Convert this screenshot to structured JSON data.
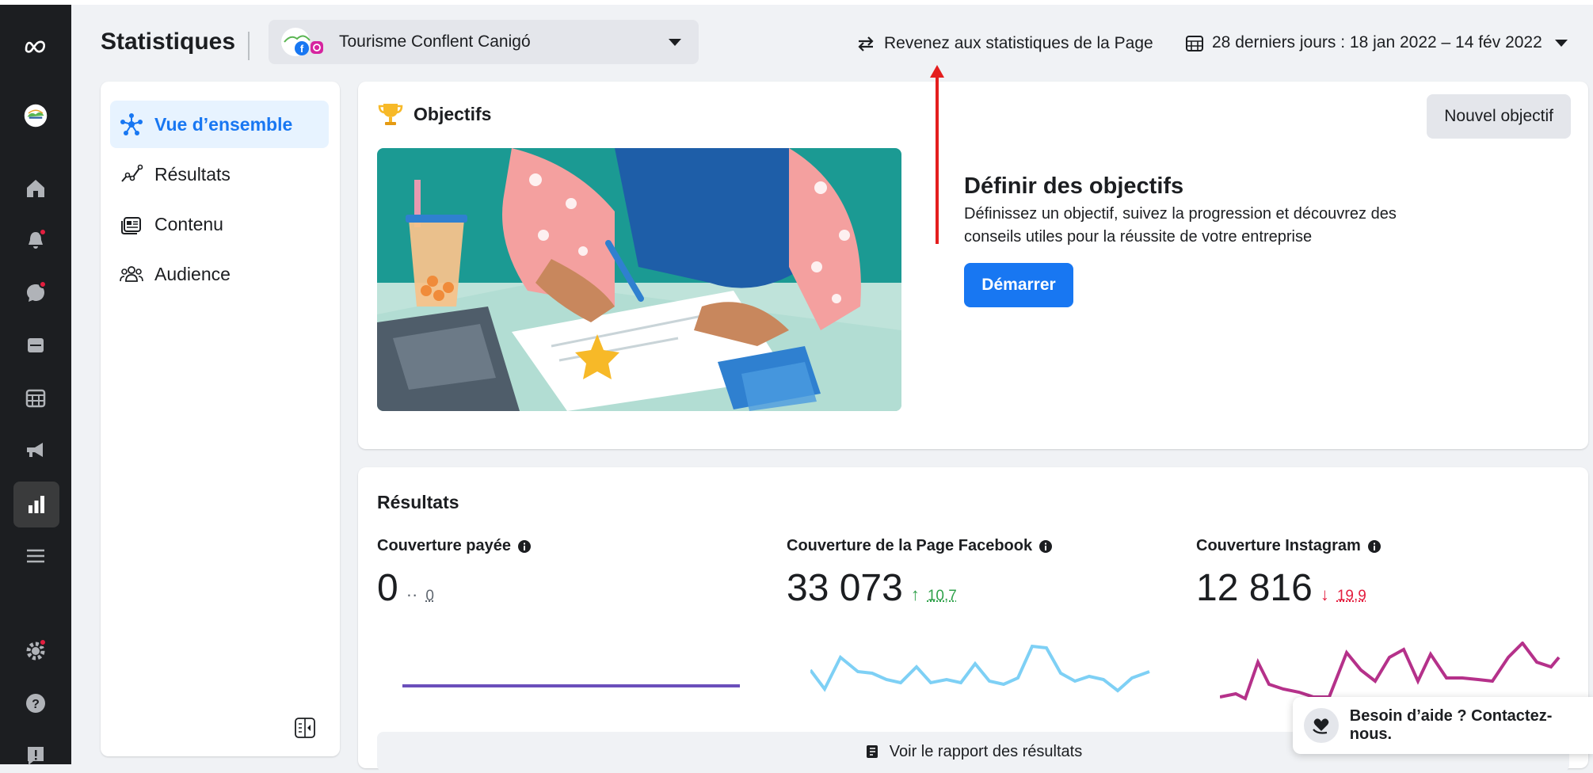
{
  "header": {
    "title": "Statistiques",
    "page_selector": "Tourisme Conflent Canigó",
    "switch_link": "Revenez aux statistiques de la Page",
    "date_range": "28 derniers jours : 18 jan 2022 – 14 fév 2022"
  },
  "sidebar": {
    "items": [
      {
        "label": "Vue d’ensemble",
        "icon": "overview-icon",
        "active": true
      },
      {
        "label": "Résultats",
        "icon": "results-icon"
      },
      {
        "label": "Contenu",
        "icon": "content-icon"
      },
      {
        "label": "Audience",
        "icon": "audience-icon"
      }
    ]
  },
  "goals": {
    "title": "Objectifs",
    "new_goal_button": "Nouvel objectif",
    "heading": "Définir des objectifs",
    "description": "Définissez un objectif, suivez la progression et découvrez des conseils utiles pour la réussite de votre entreprise",
    "start_button": "Démarrer"
  },
  "results": {
    "title": "Résultats",
    "metrics": [
      {
        "label": "Couverture payée",
        "value": "0",
        "change": "0",
        "direction": "flat",
        "color": "#6b4fbb"
      },
      {
        "label": "Couverture de la Page Facebook",
        "value": "33 073",
        "change": "10,7",
        "direction": "up",
        "color": "#7ed0f5"
      },
      {
        "label": "Couverture Instagram",
        "value": "12 816",
        "change": "19,9",
        "direction": "down",
        "color": "#b5318a"
      }
    ],
    "report_link": "Voir le rapport des résultats"
  },
  "help": {
    "label": "Besoin d’aide ? Contactez-nous."
  },
  "colors": {
    "accent": "#1877f2",
    "annotation_arrow": "#e41e1e"
  }
}
